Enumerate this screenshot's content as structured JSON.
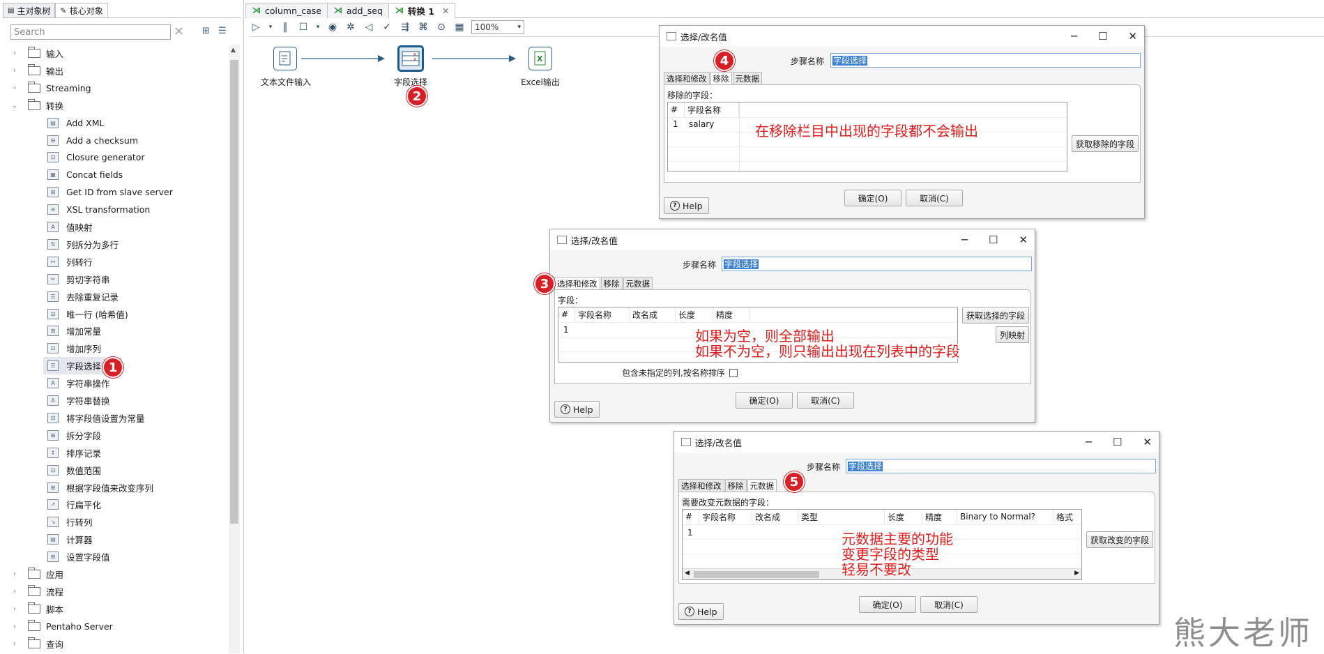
{
  "left_panel": {
    "tabs": [
      {
        "label": "主对象树",
        "active": false
      },
      {
        "label": "核心对象",
        "active": true
      }
    ],
    "search_placeholder": "Search",
    "tree": [
      {
        "label": "输入",
        "type": "folder",
        "expanded": false
      },
      {
        "label": "输出",
        "type": "folder",
        "expanded": false
      },
      {
        "label": "Streaming",
        "type": "folder",
        "expanded": false
      },
      {
        "label": "转换",
        "type": "folder",
        "expanded": true
      },
      {
        "label": "Add XML",
        "type": "step"
      },
      {
        "label": "Add a checksum",
        "type": "step"
      },
      {
        "label": "Closure generator",
        "type": "step"
      },
      {
        "label": "Concat fields",
        "type": "step"
      },
      {
        "label": "Get ID from slave server",
        "type": "step"
      },
      {
        "label": "XSL transformation",
        "type": "step"
      },
      {
        "label": "值映射",
        "type": "step"
      },
      {
        "label": "列拆分为多行",
        "type": "step"
      },
      {
        "label": "列转行",
        "type": "step"
      },
      {
        "label": "剪切字符串",
        "type": "step"
      },
      {
        "label": "去除重复记录",
        "type": "step"
      },
      {
        "label": "唯一行 (哈希值)",
        "type": "step"
      },
      {
        "label": "增加常量",
        "type": "step"
      },
      {
        "label": "增加序列",
        "type": "step"
      },
      {
        "label": "字段选择",
        "type": "step",
        "selected": true
      },
      {
        "label": "字符串操作",
        "type": "step"
      },
      {
        "label": "字符串替换",
        "type": "step"
      },
      {
        "label": "将字段值设置为常量",
        "type": "step"
      },
      {
        "label": "拆分字段",
        "type": "step"
      },
      {
        "label": "排序记录",
        "type": "step"
      },
      {
        "label": "数值范围",
        "type": "step"
      },
      {
        "label": "根据字段值来改变序列",
        "type": "step"
      },
      {
        "label": "行扁平化",
        "type": "step"
      },
      {
        "label": "行转列",
        "type": "step"
      },
      {
        "label": "计算器",
        "type": "step"
      },
      {
        "label": "设置字段值",
        "type": "step"
      },
      {
        "label": "应用",
        "type": "folder",
        "expanded": false
      },
      {
        "label": "流程",
        "type": "folder",
        "expanded": false
      },
      {
        "label": "脚本",
        "type": "folder",
        "expanded": false
      },
      {
        "label": "Pentaho Server",
        "type": "folder",
        "expanded": false
      },
      {
        "label": "查询",
        "type": "folder",
        "expanded": false
      }
    ]
  },
  "editor_tabs": [
    {
      "label": "column_case",
      "active": false
    },
    {
      "label": "add_seq",
      "active": false
    },
    {
      "label": "转换 1",
      "active": true
    }
  ],
  "toolbar": {
    "zoom": "100%"
  },
  "canvas": {
    "steps": [
      {
        "label": "文本文件输入",
        "icon": "text-file-input-icon"
      },
      {
        "label": "字段选择",
        "icon": "select-values-icon"
      },
      {
        "label": "Excel输出",
        "icon": "excel-output-icon"
      }
    ]
  },
  "badges": [
    "1",
    "2",
    "3",
    "4",
    "5"
  ],
  "dialogs": {
    "remove": {
      "title": "选择/改名值",
      "step_name_label": "步骤名称",
      "step_name_value": "字段选择",
      "tabs": [
        "选择和修改",
        "移除",
        "元数据"
      ],
      "section_label": "移除的字段：",
      "columns": [
        "#",
        "字段名称"
      ],
      "rows": [
        [
          "1",
          "salary"
        ]
      ],
      "side_button": "获取移除的字段",
      "ok": "确定(O)",
      "cancel": "取消(C)",
      "help": "Help",
      "annotation": "在移除栏目中出现的字段都不会输出"
    },
    "select": {
      "title": "选择/改名值",
      "step_name_label": "步骤名称",
      "step_name_value": "字段选择",
      "tabs": [
        "选择和修改",
        "移除",
        "元数据"
      ],
      "section_label": "字段：",
      "columns": [
        "#",
        "字段名称",
        "改名成",
        "长度",
        "精度"
      ],
      "rows": [
        [
          "1"
        ]
      ],
      "side_button_1": "获取选择的字段",
      "side_button_2": "列映射",
      "checkbox_label": "包含未指定的列,按名称排序",
      "ok": "确定(O)",
      "cancel": "取消(C)",
      "help": "Help",
      "annotation_line1": "如果为空，则全部输出",
      "annotation_line2": "如果不为空，则只输出出现在列表中的字段"
    },
    "meta": {
      "title": "选择/改名值",
      "step_name_label": "步骤名称",
      "step_name_value": "字段选择",
      "tabs": [
        "选择和修改",
        "移除",
        "元数据"
      ],
      "section_label": "需要改变元数据的字段：",
      "columns": [
        "#",
        "字段名称",
        "改名成",
        "类型",
        "长度",
        "精度",
        "Binary to Normal?",
        "格式"
      ],
      "rows": [
        [
          "1"
        ]
      ],
      "side_button": "获取改变的字段",
      "ok": "确定(O)",
      "cancel": "取消(C)",
      "help": "Help",
      "annotation_line1": "元数据主要的功能",
      "annotation_line2": "变更字段的类型",
      "annotation_line3": "轻易不要改"
    }
  },
  "watermark": "熊大老师"
}
